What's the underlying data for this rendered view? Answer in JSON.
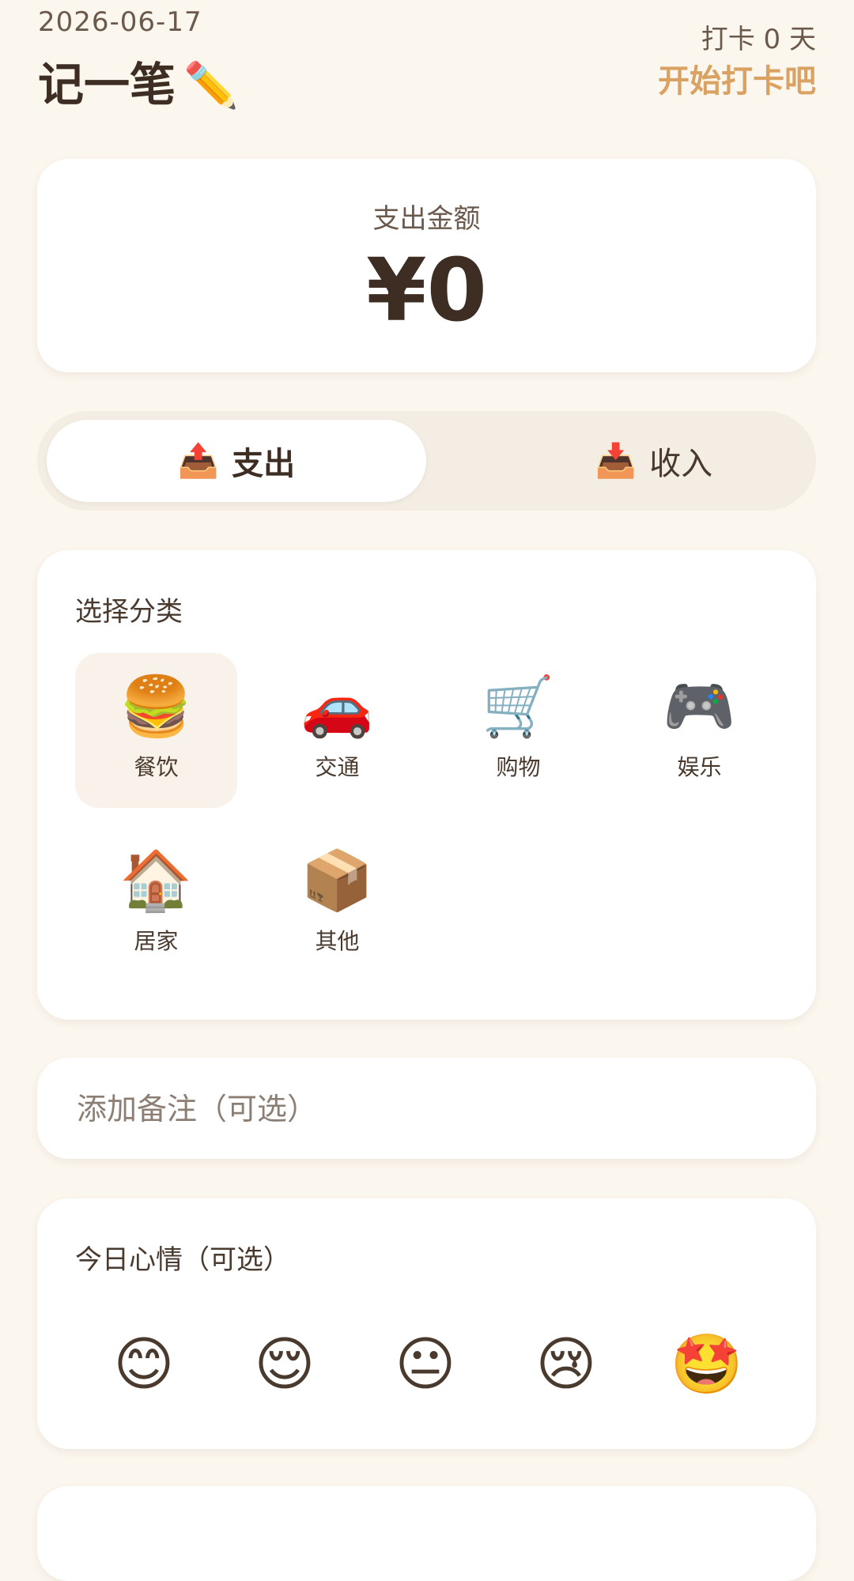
{
  "header": {
    "date": "2026-06-17",
    "title": "记一笔",
    "title_icon": "✏️",
    "checkin_days": "打卡 0 天",
    "checkin_cta": "开始打卡吧"
  },
  "amount": {
    "label": "支出金额",
    "value": "¥0"
  },
  "type_toggle": {
    "expense": {
      "icon": "📤",
      "label": "支出",
      "selected": true
    },
    "income": {
      "icon": "📥",
      "label": "收入",
      "selected": false
    }
  },
  "category": {
    "title": "选择分类",
    "items": [
      {
        "icon": "🍔",
        "label": "餐饮",
        "selected": true
      },
      {
        "icon": "🚗",
        "label": "交通",
        "selected": false
      },
      {
        "icon": "🛒",
        "label": "购物",
        "selected": false
      },
      {
        "icon": "🎮",
        "label": "娱乐",
        "selected": false
      },
      {
        "icon": "🏠",
        "label": "居家",
        "selected": false
      },
      {
        "icon": "📦",
        "label": "其他",
        "selected": false
      }
    ]
  },
  "note": {
    "placeholder": "添加备注（可选）",
    "value": ""
  },
  "mood": {
    "title": "今日心情（可选）",
    "options": [
      "😊",
      "😌",
      "😐",
      "😢",
      "🤩"
    ]
  },
  "colors": {
    "background": "#FBF6EE",
    "card": "#FFFFFF",
    "accent": "#D9A262",
    "text_dark": "#3E2D22",
    "selected_bg": "#F8F2EA"
  }
}
